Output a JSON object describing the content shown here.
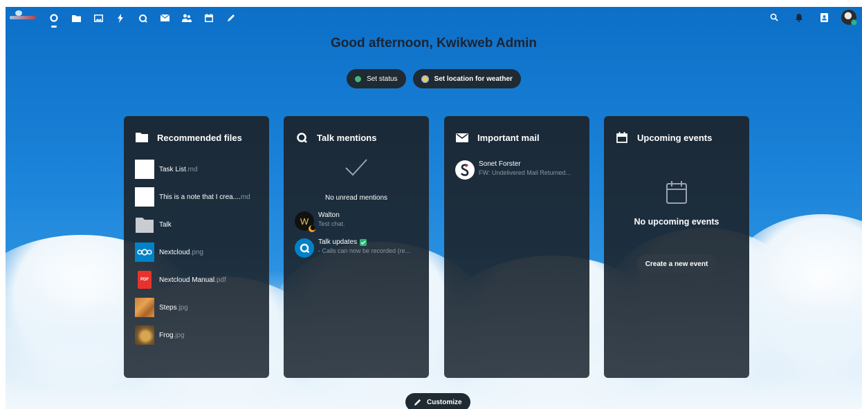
{
  "header": {
    "nav_items": [
      {
        "name": "dashboard-icon",
        "active": true
      },
      {
        "name": "files-icon"
      },
      {
        "name": "photos-icon"
      },
      {
        "name": "activity-icon"
      },
      {
        "name": "talk-icon"
      },
      {
        "name": "mail-icon"
      },
      {
        "name": "contacts-icon"
      },
      {
        "name": "calendar-icon"
      },
      {
        "name": "notes-icon"
      }
    ],
    "right_icons": [
      "search-icon",
      "notifications-icon",
      "contacts-menu-icon",
      "user-avatar"
    ]
  },
  "greeting": "Good afternoon, Kwikweb Admin",
  "status_buttons": {
    "set_status": "Set status",
    "set_location": "Set location for weather"
  },
  "widgets": {
    "recommended_files": {
      "title": "Recommended files",
      "items": [
        {
          "name": "Task List",
          "ext": ".md",
          "thumb": "blank"
        },
        {
          "name": "This is a note that I crea....",
          "ext": "md",
          "thumb": "blank"
        },
        {
          "name": "Talk",
          "ext": "",
          "thumb": "folder"
        },
        {
          "name": "Nextcloud",
          "ext": ".png",
          "thumb": "nextcloud"
        },
        {
          "name": "Nextcloud Manual",
          "ext": ".pdf",
          "thumb": "pdf"
        },
        {
          "name": "Steps",
          "ext": ".jpg",
          "thumb": "steps"
        },
        {
          "name": "Frog",
          "ext": ".jpg",
          "thumb": "frog"
        }
      ],
      "pdf_label": "PDF"
    },
    "talk_mentions": {
      "title": "Talk mentions",
      "empty_text": "No unread mentions",
      "items": [
        {
          "name": "Walton",
          "sub": "Test chat.",
          "avatar_letter": "W"
        },
        {
          "name": "Talk updates",
          "sub": "- Calls can now be recorded (re..."
        }
      ]
    },
    "important_mail": {
      "title": "Important mail",
      "items": [
        {
          "from": "Sonet Forster",
          "subject": "FW: Undelivered Mail Returned..."
        }
      ]
    },
    "upcoming_events": {
      "title": "Upcoming events",
      "empty_text": "No upcoming events",
      "button": "Create a new event"
    }
  },
  "customize_label": "Customize",
  "colors": {
    "sky_top": "#0d6fc7",
    "panel_bg": "#1b2733",
    "status_green": "#3fb97a",
    "accent_blue": "#0082c9"
  }
}
